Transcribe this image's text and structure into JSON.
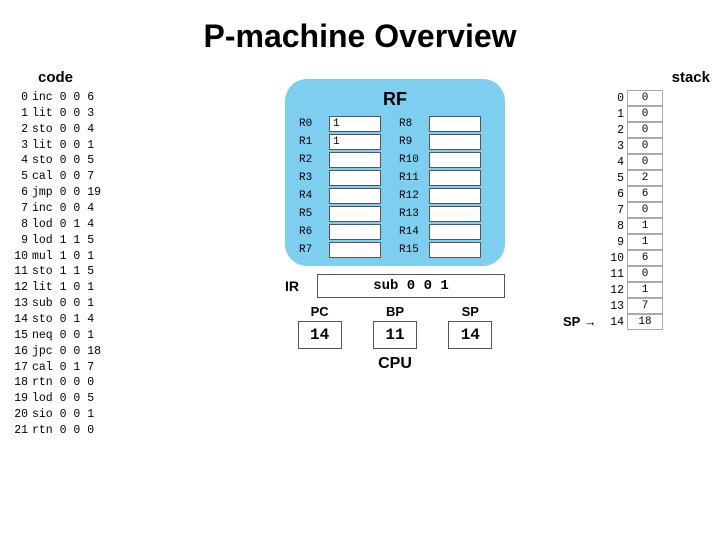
{
  "title": "P-machine Overview",
  "code": {
    "label": "code",
    "rows": [
      {
        "ln": "0",
        "instr": "inc 0 0 6"
      },
      {
        "ln": "1",
        "instr": "lit 0 0 3"
      },
      {
        "ln": "2",
        "instr": "sto 0 0 4"
      },
      {
        "ln": "3",
        "instr": "lit 0 0 1"
      },
      {
        "ln": "4",
        "instr": "sto 0 0 5"
      },
      {
        "ln": "5",
        "instr": "cal 0 0 7"
      },
      {
        "ln": "6",
        "instr": "jmp 0 0 19"
      },
      {
        "ln": "7",
        "instr": "inc 0 0 4"
      },
      {
        "ln": "8",
        "instr": "lod 0 1 4"
      },
      {
        "ln": "9",
        "instr": "lod 1 1 5"
      },
      {
        "ln": "10",
        "instr": "mul 1 0 1"
      },
      {
        "ln": "11",
        "instr": "sto 1 1 5"
      },
      {
        "ln": "12",
        "instr": "lit 1 0 1"
      },
      {
        "ln": "13",
        "instr": "sub 0 0 1"
      },
      {
        "ln": "14",
        "instr": "sto 0 1 4"
      },
      {
        "ln": "15",
        "instr": "neq 0 0 1"
      },
      {
        "ln": "16",
        "instr": "jpc 0 0 18"
      },
      {
        "ln": "17",
        "instr": "cal 0 1 7"
      },
      {
        "ln": "18",
        "instr": "rtn 0 0 0"
      },
      {
        "ln": "19",
        "instr": "lod 0 0 5"
      },
      {
        "ln": "20",
        "instr": "sio 0 0 1"
      },
      {
        "ln": "21",
        "instr": "rtn 0 0 0"
      }
    ],
    "pc_row": 14,
    "pc_label": "PC"
  },
  "rf": {
    "title": "RF",
    "left": [
      {
        "name": "R0",
        "value": "1"
      },
      {
        "name": "R1",
        "value": "1"
      },
      {
        "name": "R2",
        "value": ""
      },
      {
        "name": "R3",
        "value": ""
      },
      {
        "name": "R4",
        "value": ""
      },
      {
        "name": "R5",
        "value": ""
      },
      {
        "name": "R6",
        "value": ""
      },
      {
        "name": "R7",
        "value": ""
      }
    ],
    "right": [
      {
        "name": "R8",
        "value": ""
      },
      {
        "name": "R9",
        "value": ""
      },
      {
        "name": "R10",
        "value": ""
      },
      {
        "name": "R11",
        "value": ""
      },
      {
        "name": "R12",
        "value": ""
      },
      {
        "name": "R13",
        "value": ""
      },
      {
        "name": "R14",
        "value": ""
      },
      {
        "name": "R15",
        "value": ""
      }
    ]
  },
  "ir": {
    "label": "IR",
    "value": "sub 0 0 1"
  },
  "cpu": {
    "label": "CPU",
    "pc_label": "PC",
    "pc_value": "14",
    "bp_label": "BP",
    "bp_value": "11",
    "sp_label": "SP",
    "sp_value": "14"
  },
  "stack": {
    "label": "stack",
    "rows": [
      {
        "idx": "0",
        "value": "0"
      },
      {
        "idx": "1",
        "value": "0"
      },
      {
        "idx": "2",
        "value": "0"
      },
      {
        "idx": "3",
        "value": "0"
      },
      {
        "idx": "4",
        "value": "0"
      },
      {
        "idx": "5",
        "value": "2"
      },
      {
        "idx": "6",
        "value": "6"
      },
      {
        "idx": "7",
        "value": "0"
      },
      {
        "idx": "8",
        "value": "1"
      },
      {
        "idx": "9",
        "value": "1"
      },
      {
        "idx": "10",
        "value": "6"
      },
      {
        "idx": "11",
        "value": "0"
      },
      {
        "idx": "12",
        "value": "1"
      },
      {
        "idx": "13",
        "value": "7"
      },
      {
        "idx": "14",
        "value": "18"
      }
    ],
    "sp_row": 14,
    "sp_label": "SP"
  }
}
